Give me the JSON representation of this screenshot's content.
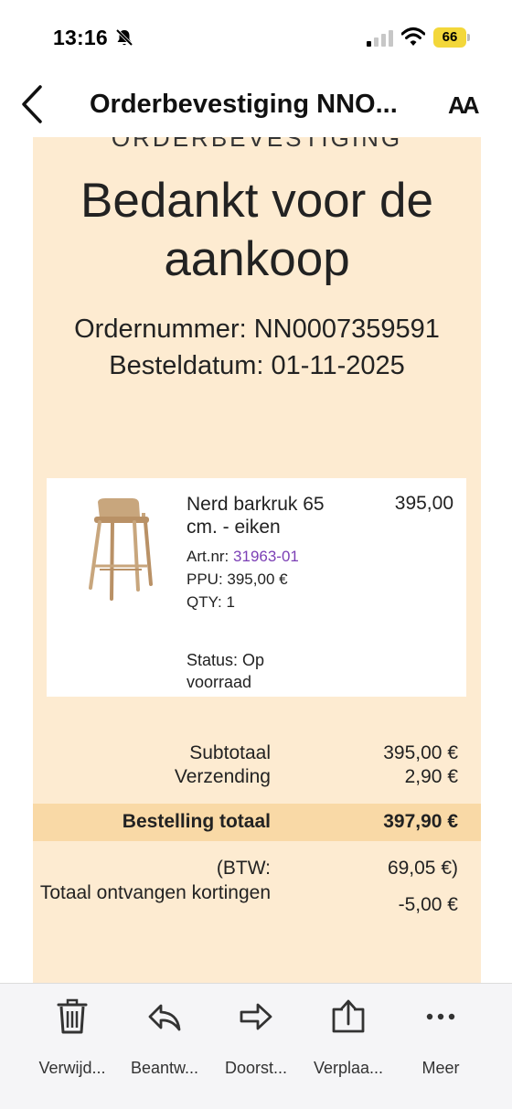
{
  "status_bar": {
    "time": "13:16",
    "battery": "66"
  },
  "nav": {
    "title": "Orderbevestiging NNO...",
    "text_size": "AA"
  },
  "email": {
    "cut_heading": "ORDERBEVESTIGING",
    "headline": "Bedankt voor de aankoop",
    "order_number": "Ordernummer: NN0007359591",
    "order_date": "Besteldatum: 01-11-2025",
    "item": {
      "name": "Nerd barkruk 65 cm. - eiken",
      "price": "395,00",
      "art_label": "Art.nr:",
      "art_number": "31963-01",
      "ppu": "PPU:  395,00 €",
      "qty": "QTY: 1",
      "status": "Status: Op voorraad"
    },
    "subtotal_label": "Subtotaal",
    "subtotal_value": "395,00 €",
    "shipping_label": "Verzending",
    "shipping_value": "2,90 €",
    "total_label": "Bestelling totaal",
    "total_value": "397,90 €",
    "vat_label": "(BTW:",
    "vat_value": "69,05 €)",
    "discount_label": "Totaal ontvangen kortingen",
    "discount_value": "-5,00 €"
  },
  "toolbar": {
    "delete": "Verwijd...",
    "reply": "Beantw...",
    "forward": "Doorst...",
    "move": "Verplaa...",
    "more": "Meer"
  },
  "colors": {
    "email_background": "#fdebd1",
    "total_bar": "#f9d9a6",
    "link": "#7b3fb5",
    "battery": "#f3d73a"
  }
}
